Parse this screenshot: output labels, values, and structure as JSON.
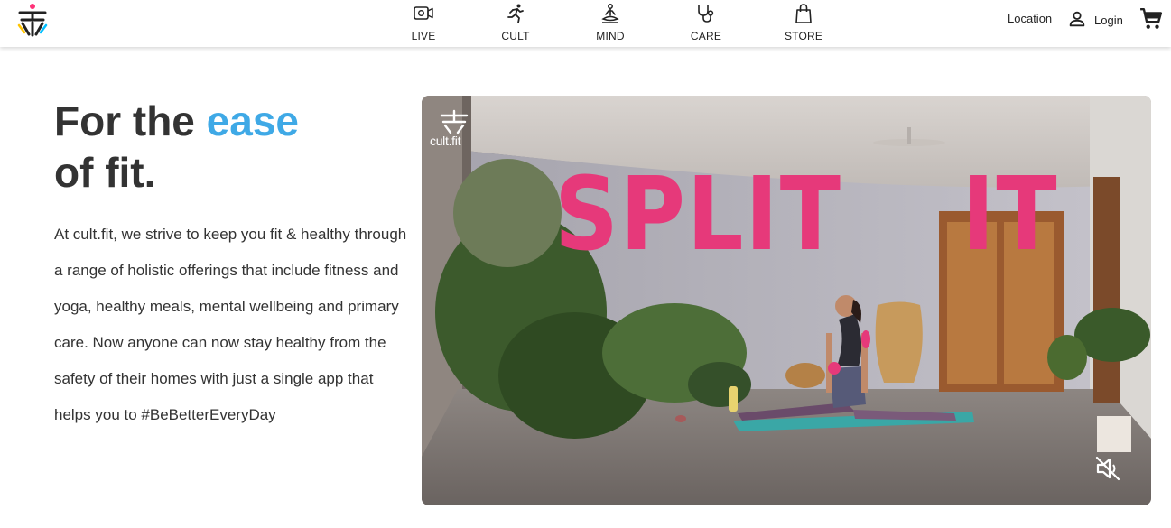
{
  "header": {
    "nav": [
      {
        "label": "LIVE",
        "icon": "video-camera-icon"
      },
      {
        "label": "CULT",
        "icon": "running-person-icon"
      },
      {
        "label": "MIND",
        "icon": "meditation-icon"
      },
      {
        "label": "CARE",
        "icon": "stethoscope-icon"
      },
      {
        "label": "STORE",
        "icon": "shopping-bag-icon"
      }
    ],
    "location_label": "Location",
    "login_label": "Login"
  },
  "hero": {
    "headline_part1": "For the ",
    "headline_accent": "ease",
    "headline_part2": "of fit.",
    "accent_color": "#3fa9e6",
    "description": "At cult.fit, we strive to keep you fit & healthy through a range of holistic offerings that include fitness and yoga, healthy meals, mental wellbeing and primary care. Now anyone can now stay healthy from the safety of their homes with just a single app that helps you to #BeBetterEveryDay"
  },
  "video": {
    "watermark": "cult.fit",
    "overlay_word1": "SPLIT",
    "overlay_word2": "IT",
    "overlay_color": "#e6397a",
    "mute_icon": "speaker-muted-icon"
  }
}
